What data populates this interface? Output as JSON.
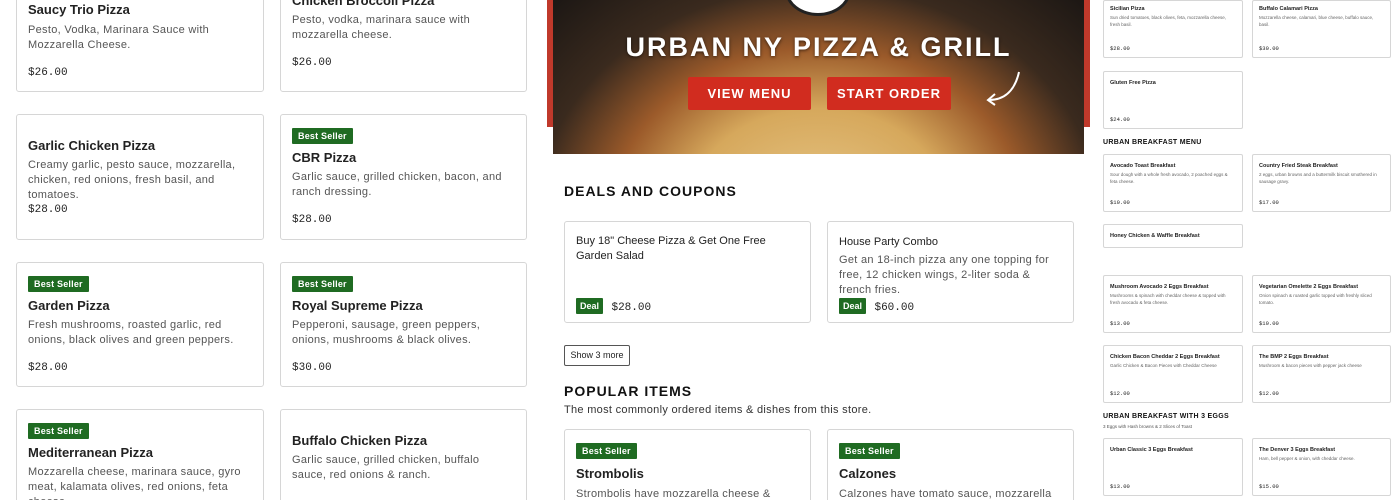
{
  "menu_left": [
    {
      "badge": "",
      "title": "Saucy Trio Pizza",
      "desc": "Pesto, Vodka, Marinara Sauce with Mozzarella Cheese.",
      "price": "$26.00"
    },
    {
      "badge": "",
      "title": "Chicken Broccoli Pizza",
      "desc": "Pesto, vodka, marinara sauce with mozzarella cheese.",
      "price": "$26.00"
    },
    {
      "badge": "",
      "title": "Garlic Chicken Pizza",
      "desc": "Creamy garlic, pesto sauce, mozzarella, chicken, red onions, fresh basil, and tomatoes.",
      "price": "$28.00"
    },
    {
      "badge": "Best Seller",
      "title": "CBR Pizza",
      "desc": "Garlic sauce, grilled chicken, bacon, and ranch dressing.",
      "price": "$28.00"
    },
    {
      "badge": "Best Seller",
      "title": "Garden Pizza",
      "desc": "Fresh mushrooms, roasted garlic, red onions, black olives and green peppers.",
      "price": "$28.00"
    },
    {
      "badge": "Best Seller",
      "title": "Royal Supreme Pizza",
      "desc": "Pepperoni, sausage, green peppers, onions, mushrooms & black olives.",
      "price": "$30.00"
    },
    {
      "badge": "Best Seller",
      "title": "Mediterranean Pizza",
      "desc": "Mozzarella cheese, marinara sauce, gyro meat, kalamata olives, red onions, feta cheese",
      "price": ""
    },
    {
      "badge": "",
      "title": "Buffalo Chicken Pizza",
      "desc": "Garlic sauce, grilled chicken, buffalo sauce, red onions & ranch.",
      "price": ""
    }
  ],
  "hero": {
    "title": "URBAN NY PIZZA & GRILL",
    "view_menu": "VIEW MENU",
    "start_order": "START ORDER"
  },
  "deals": {
    "heading": "DEALS AND COUPONS",
    "items": [
      {
        "title": "Buy 18\" Cheese Pizza & Get One Free Garden Salad",
        "desc": "",
        "tag": "Deal",
        "price": "$28.00"
      },
      {
        "title": "House Party Combo",
        "desc": "Get an 18-inch pizza any one topping for free, 12 chicken wings, 2-liter soda & french fries.",
        "tag": "Deal",
        "price": "$60.00"
      }
    ],
    "show_more": "Show 3 more"
  },
  "popular": {
    "heading": "POPULAR ITEMS",
    "subtitle": "The most commonly ordered items & dishes from this store.",
    "items": [
      {
        "badge": "Best Seller",
        "title": "Strombolis",
        "desc": "Strombolis have mozzarella cheese & tomato"
      },
      {
        "badge": "Best Seller",
        "title": "Calzones",
        "desc": "Calzones have tomato sauce, mozzarella & ricotta"
      }
    ]
  },
  "mini_menu": {
    "top": [
      {
        "title": "Sicilian Pizza",
        "desc": "Sun dried tomatoes, black olives, feta, mozzarella cheese, fresh basil.",
        "price": "$28.00"
      },
      {
        "title": "Buffalo Calamari Pizza",
        "desc": "Mozzarella cheese, calamari, blue cheese, buffalo sauce, basil.",
        "price": "$30.00"
      },
      {
        "title": "Gluten Free Pizza",
        "desc": "",
        "price": "$24.00"
      }
    ],
    "breakfast_heading": "URBAN BREAKFAST MENU",
    "breakfast": [
      {
        "title": "Avocado Toast Breakfast",
        "desc": "Sour dough with a whole fresh avocado, 2 poached eggs & feta cheese.",
        "price": "$10.00"
      },
      {
        "title": "Country Fried Steak Breakfast",
        "desc": "2 eggs, urban browns and a buttermilk biscuit smothered in sausage gravy.",
        "price": "$17.00"
      },
      {
        "title": "Honey Chicken & Waffle Breakfast",
        "desc": "",
        "price": ""
      },
      {
        "title": "Mushroom Avocado 2 Eggs Breakfast",
        "desc": "Mushrooms & spinach with cheddar cheese & topped with fresh avocado & feta cheese.",
        "price": "$13.00"
      },
      {
        "title": "Vegetarian Omelette 2 Eggs Breakfast",
        "desc": "Onion spinach & roasted garlic topped with freshly sliced tomato.",
        "price": "$10.00"
      },
      {
        "title": "Chicken Bacon Cheddar 2 Eggs Breakfast",
        "desc": "Garlic Chicken & Bacon Pieces with Cheddar Cheese",
        "price": "$12.00"
      },
      {
        "title": "The BMP 2 Eggs Breakfast",
        "desc": "Mushroom & bacon pieces with pepper jack cheese",
        "price": "$12.00"
      }
    ],
    "three_eggs_heading": "URBAN BREAKFAST WITH 3 EGGS",
    "three_eggs_sub": "3 Eggs with Hash browns & 2 Slices of Toast",
    "three_eggs": [
      {
        "title": "Urban Classic 3 Eggs Breakfast",
        "desc": "",
        "price": "$13.00"
      },
      {
        "title": "The Denver 3 Eggs Breakfast",
        "desc": "Ham, bell pepper & onion, with cheddar cheese.",
        "price": "$15.00"
      }
    ]
  },
  "colors": {
    "brand_red": "#d12c1f",
    "badge_green": "#1f6b22"
  }
}
